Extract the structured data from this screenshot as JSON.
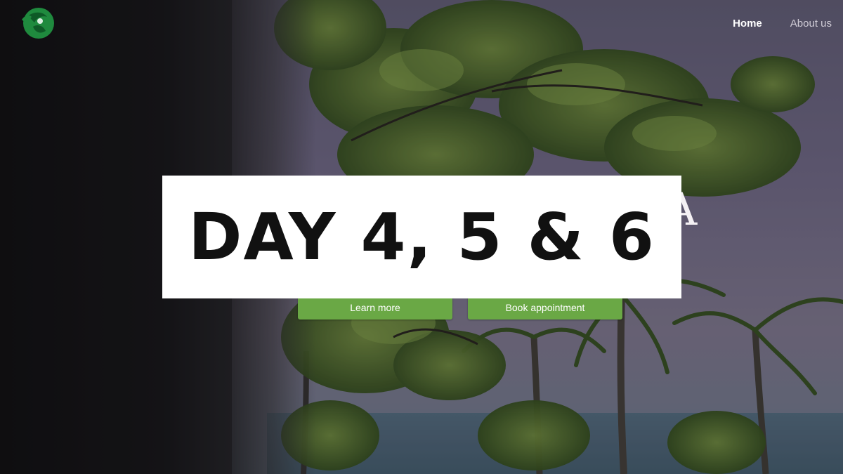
{
  "nav": {
    "logo_icon": "leaf-globe-logo-icon",
    "items": [
      {
        "label": "Home"
      },
      {
        "label": "About us"
      }
    ]
  },
  "hero": {
    "title_fragment": "A",
    "buttons": {
      "learn_more": "Learn more",
      "book_appointment": "Book appointment"
    }
  },
  "overlay_card": {
    "text": "DAY 4, 5 & 6"
  },
  "colors": {
    "accent_green": "#6aa845",
    "logo_green": "#1f8a3e",
    "card_background": "#ffffff"
  }
}
